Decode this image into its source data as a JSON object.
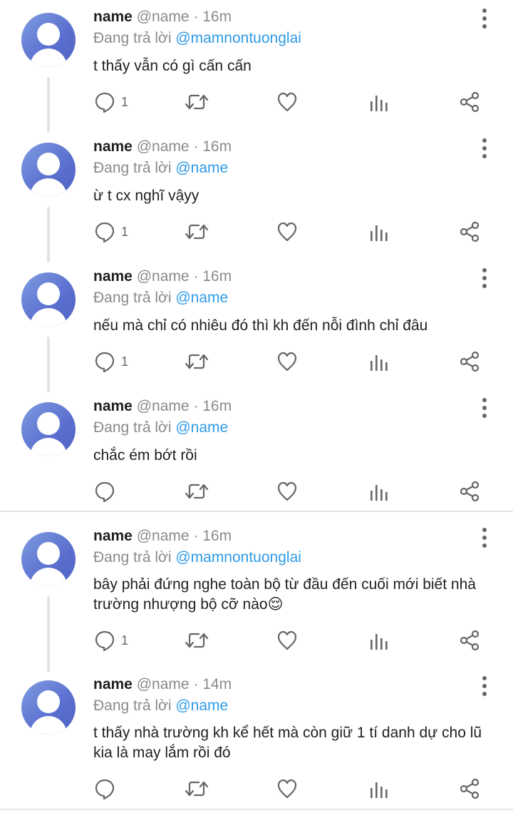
{
  "tweets": [
    {
      "name": "name",
      "handle": "@name",
      "time": "16m",
      "reply_prefix": "Đang trả lời",
      "reply_to": "@mamnontuonglai",
      "text": "t thấy vẫn có gì cấn cấn",
      "reply_count": "1"
    },
    {
      "name": "name",
      "handle": "@name",
      "time": "16m",
      "reply_prefix": "Đang trả lời",
      "reply_to": "@name",
      "text": "ừ t cx nghĩ vậyy",
      "reply_count": "1"
    },
    {
      "name": "name",
      "handle": "@name",
      "time": "16m",
      "reply_prefix": "Đang trả lời",
      "reply_to": "@name",
      "text": "nếu mà chỉ có nhiêu đó thì kh đến nỗi đình chỉ đâu",
      "reply_count": "1"
    },
    {
      "name": "name",
      "handle": "@name",
      "time": "16m",
      "reply_prefix": "Đang trả lời",
      "reply_to": "@name",
      "text": "chắc ém bớt rồi",
      "reply_count": ""
    },
    {
      "name": "name",
      "handle": "@name",
      "time": "16m",
      "reply_prefix": "Đang trả lời",
      "reply_to": "@mamnontuonglai",
      "text": "bây phải đứng nghe toàn bộ từ đầu đến cuối mới biết nhà trường nhượng bộ cỡ nào😌",
      "reply_count": "1"
    },
    {
      "name": "name",
      "handle": "@name",
      "time": "14m",
      "reply_prefix": "Đang trả lời",
      "reply_to": "@name",
      "text": "t thấy nhà trường kh kể hết mà còn giữ 1 tí danh dự cho lũ kia là may lắm rồi đó",
      "reply_count": ""
    }
  ],
  "separator": " · ",
  "colors": {
    "accent": "#2e9be6",
    "meta": "#8a8a8a",
    "icon": "#666666",
    "avatar": "#5b6fcf"
  },
  "icons": [
    "reply-icon",
    "retweet-icon",
    "like-icon",
    "analytics-icon",
    "share-icon",
    "more-options-icon"
  ]
}
